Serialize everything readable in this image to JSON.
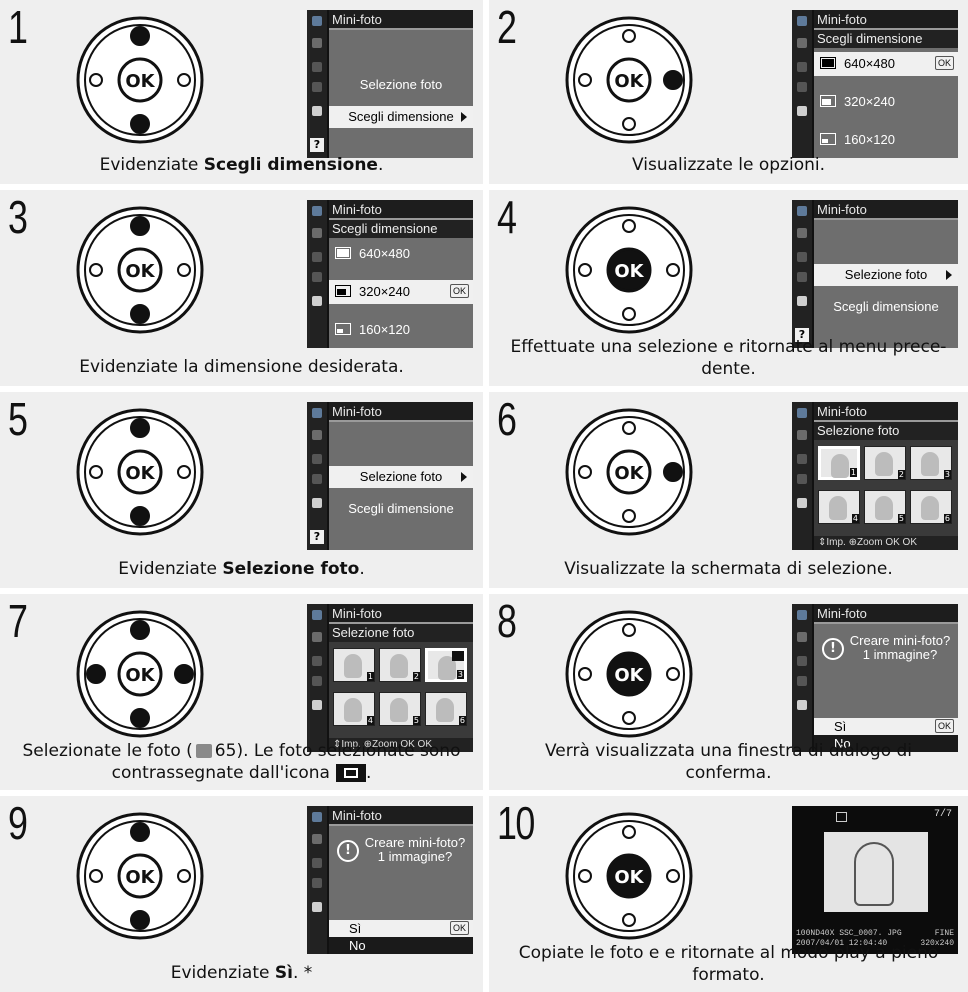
{
  "steps": [
    {
      "number": "1",
      "caption_pre": "Evidenziate ",
      "caption_bold": "Scegli dimensione",
      "caption_post": ".",
      "caption_line2": "",
      "screen": {
        "title": "Mini-foto",
        "items": [
          "Selezione foto",
          "Scegli dimensione"
        ]
      }
    },
    {
      "number": "2",
      "caption_pre": "Visualizzate le opzioni.",
      "caption_bold": "",
      "caption_post": "",
      "caption_line2": "",
      "screen": {
        "title": "Mini-foto",
        "subtitle": "Scegli dimensione",
        "sizes": [
          "640×480",
          "320×240",
          "160×120"
        ],
        "ok": "OK"
      }
    },
    {
      "number": "3",
      "caption_pre": "Evidenziate la dimensione desiderata.",
      "caption_bold": "",
      "caption_post": "",
      "caption_line2": "",
      "screen": {
        "title": "Mini-foto",
        "subtitle": "Scegli dimensione",
        "sizes": [
          "640×480",
          "320×240",
          "160×120"
        ],
        "ok": "OK"
      }
    },
    {
      "number": "4",
      "caption_pre": "Effettuate una selezione e ritornate al menu prece-",
      "caption_bold": "",
      "caption_post": "",
      "caption_line2": "dente.",
      "screen": {
        "title": "Mini-foto",
        "items": [
          "Selezione foto",
          "Scegli dimensione"
        ]
      }
    },
    {
      "number": "5",
      "caption_pre": "Evidenziate ",
      "caption_bold": "Selezione foto",
      "caption_post": ".",
      "caption_line2": "",
      "screen": {
        "title": "Mini-foto",
        "items": [
          "Selezione foto",
          "Scegli dimensione"
        ]
      }
    },
    {
      "number": "6",
      "caption_pre": "Visualizzate la schermata di selezione.",
      "caption_bold": "",
      "caption_post": "",
      "caption_line2": "",
      "screen": {
        "title": "Mini-foto",
        "subtitle": "Selezione foto",
        "thumbs": [
          "1",
          "2",
          "3",
          "4",
          "5",
          "6"
        ],
        "footer": "⇕Imp. ⊕Zoom  OK OK"
      }
    },
    {
      "number": "7",
      "caption_pre": "Selezionate le foto (",
      "caption_ref": "65",
      "caption_mid": ").  Le foto selezionate sono",
      "caption_bold": "",
      "caption_post": "",
      "caption_line2": "contrassegnate dall'icona",
      "screen": {
        "title": "Mini-foto",
        "subtitle": "Selezione foto",
        "thumbs": [
          "1",
          "2",
          "3",
          "4",
          "5",
          "6"
        ],
        "footer": "⇕Imp. ⊕Zoom  OK OK"
      }
    },
    {
      "number": "8",
      "caption_pre": "Verrà visualizzata una finestra di dialogo di",
      "caption_bold": "",
      "caption_post": "",
      "caption_line2": "conferma.",
      "screen": {
        "title": "Mini-foto",
        "message": "Creare mini-foto? 1 immagine?",
        "options": [
          "Sì",
          "No"
        ],
        "ok": "OK"
      }
    },
    {
      "number": "9",
      "caption_pre": "Evidenziate ",
      "caption_bold": "Sì",
      "caption_post": ". *",
      "caption_line2": "",
      "screen": {
        "title": "Mini-foto",
        "message": "Creare mini-foto? 1 immagine?",
        "options": [
          "Sì",
          "No"
        ],
        "ok": "OK"
      }
    },
    {
      "number": "10",
      "caption_pre": "Copiate le foto e e ritornate al modo play a pieno",
      "caption_bold": "",
      "caption_post": "",
      "caption_line2": "formato.",
      "screen": {
        "counter": "7/7",
        "info_left": "100ND40X   SSC_0007. JPG",
        "info_date": "2007/04/01  12:04:40",
        "info_right": "FINE",
        "info_size": "320x240"
      }
    }
  ],
  "colors": {
    "panel_bg": "#efefef",
    "screen_bg": "#111111",
    "menu_bg": "#6e6e6e",
    "highlight": "#f0f0f0"
  },
  "icons": {
    "dpad": "multi-selector-icon",
    "ok": "ok-button-icon",
    "reference": "page-reference-icon",
    "small_picture": "small-picture-icon"
  }
}
